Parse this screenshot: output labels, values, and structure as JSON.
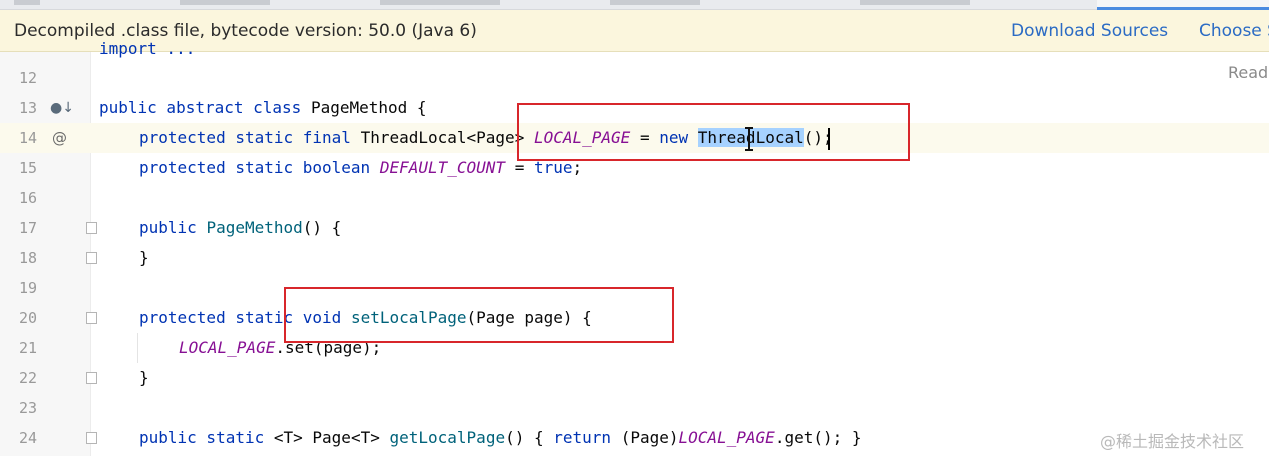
{
  "banner": {
    "message": "Decompiled .class file, bytecode version: 50.0 (Java 6)",
    "download_sources": "Download Sources",
    "choose_sources": "Choose S"
  },
  "reader_mode": "Read",
  "editor": {
    "partial_top_line": "import ...",
    "lines": [
      {
        "number": "12",
        "text": ""
      },
      {
        "number": "13",
        "text": "public abstract class PageMethod {"
      },
      {
        "number": "14",
        "text": "protected static final ThreadLocal<Page> LOCAL_PAGE = new ThreadLocal();"
      },
      {
        "number": "15",
        "text": "protected static boolean DEFAULT_COUNT = true;"
      },
      {
        "number": "16",
        "text": ""
      },
      {
        "number": "17",
        "text": "public PageMethod() {"
      },
      {
        "number": "18",
        "text": "}"
      },
      {
        "number": "19",
        "text": ""
      },
      {
        "number": "20",
        "text": "protected static void setLocalPage(Page page) {"
      },
      {
        "number": "21",
        "text": "LOCAL_PAGE.set(page);"
      },
      {
        "number": "22",
        "text": "}"
      },
      {
        "number": "23",
        "text": ""
      },
      {
        "number": "24",
        "text": "public static <T> Page<T> getLocalPage() { return (Page)LOCAL_PAGE.get(); }"
      }
    ],
    "tokens": {
      "l13_kw": "public abstract class",
      "l13_name": "PageMethod {",
      "l14_kw1": "protected static final",
      "l14_type": "ThreadLocal<Page>",
      "l14_field": "LOCAL_PAGE",
      "l14_eq": "=",
      "l14_new": "new",
      "l14_sel": "ThreadLocal",
      "l14_end": "();",
      "l15_kw": "protected static boolean",
      "l15_field": "DEFAULT_COUNT",
      "l15_eq": "=",
      "l15_true": "true",
      "l15_semi": ";",
      "l17_kw": "public",
      "l17_meth": "PageMethod",
      "l17_end": "() {",
      "l18_brace": "}",
      "l20_kw": "protected static void",
      "l20_meth": "setLocalPage",
      "l20_end": "(Page page) {",
      "l21_field": "LOCAL_PAGE",
      "l21_end": ".set(page);",
      "l22_brace": "}",
      "l24_kw": "public static",
      "l24_sig": "<T> Page<T>",
      "l24_meth": "getLocalPage",
      "l24_open": "() {",
      "l24_ret": "return",
      "l24_cast": "(Page)",
      "l24_field": "LOCAL_PAGE",
      "l24_end": ".get(); }"
    }
  },
  "gutter_icons": {
    "line13": "implemented-down-icon",
    "line14": "at-override-icon"
  },
  "watermark": "@稀土掘金技术社区",
  "colors": {
    "keyword": "#0033b3",
    "field": "#871094",
    "method": "#00627a",
    "selection": "#a6d2ff",
    "annotation_box": "#d8262b",
    "link": "#2b6bc4",
    "banner_bg": "#fbf6dd"
  }
}
